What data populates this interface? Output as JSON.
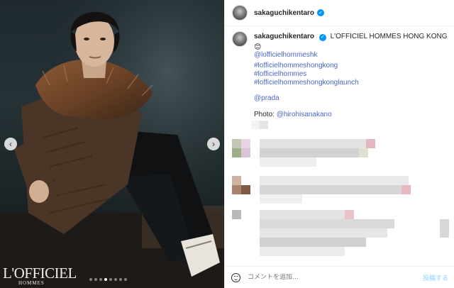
{
  "post": {
    "username": "sakaguchikentaro",
    "verified_icon": "verified-badge-icon",
    "caption_title": "L'OFFICIEL HOMMES HONG KONG",
    "caption_emoji": "😊",
    "tags": [
      "@lofficielhommeshk",
      "#lofficielhommeshongkong",
      "#lofficielhommes",
      "#lofficielhommeshongkonglaunch"
    ],
    "mention": "@prada",
    "photo_label": "Photo:",
    "photo_credit": "@hirohisanakano"
  },
  "media": {
    "logo_main": "L'OFFICIEL",
    "logo_sub": "HOMMES",
    "carousel_count": 8,
    "carousel_active": 3,
    "prev_icon": "chevron-left-icon",
    "next_icon": "chevron-right-icon"
  },
  "footer": {
    "emoji_icon": "smiley-icon",
    "comment_placeholder": "コメントを追加...",
    "post_label": "投稿する"
  },
  "colors": {
    "link": "#4a67c6",
    "accent": "#0095f6",
    "post_disabled": "#b2dffc"
  }
}
